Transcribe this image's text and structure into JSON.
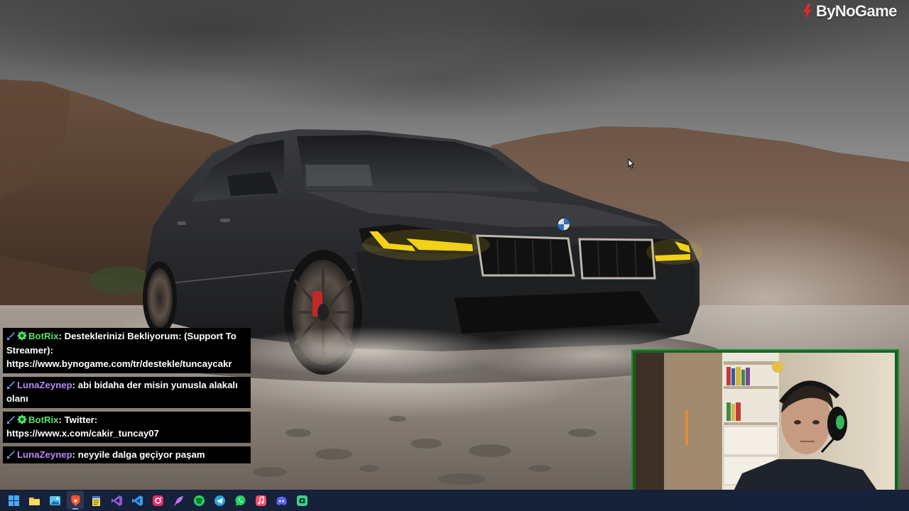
{
  "brand": {
    "name": "ByNoGame",
    "icon": "bynogame-logo-icon"
  },
  "wallpaper": {
    "subject": "car-wallpaper",
    "accent_headlight": "#f2d21a"
  },
  "chat": {
    "messages": [
      {
        "badge": "sword-icon",
        "bot_badge": "bot-icon",
        "user": "BotRix",
        "user_class": "botrix",
        "text": "Desteklerinizi Bekliyorum: (Support To Streamer): https://www.bynogame.com/tr/destekle/tuncaycakr"
      },
      {
        "badge": "sword-icon",
        "user": "LunaZeynep",
        "user_class": "luna",
        "text": "abi bidaha der misin yunusla alakalı olanı"
      },
      {
        "badge": "sword-icon",
        "bot_badge": "bot-icon",
        "user": "BotRix",
        "user_class": "botrix",
        "text": "Twitter: https://www.x.com/cakir_tuncay07"
      },
      {
        "badge": "sword-icon",
        "user": "LunaZeynep",
        "user_class": "luna",
        "text": "neyyile dalga geçiyor paşam"
      }
    ],
    "colors": {
      "botrix": "#57e36f",
      "luna": "#b88af5",
      "bg": "#000000"
    }
  },
  "webcam": {
    "frame_color": "#2a8a30"
  },
  "taskbar": {
    "apps": [
      {
        "name": "windows-start-icon",
        "color": "#4aa8ff"
      },
      {
        "name": "file-explorer-icon",
        "color": "#f5c342"
      },
      {
        "name": "photos-icon",
        "color": "#5cc0f0"
      },
      {
        "name": "brave-browser-icon",
        "color": "#fb542b",
        "active": true
      },
      {
        "name": "notepad-icon",
        "color": "#f0d64a"
      },
      {
        "name": "visual-studio-icon",
        "color": "#8a5cd6"
      },
      {
        "name": "vscode-icon",
        "color": "#2f9cf0"
      },
      {
        "name": "instagram-icon",
        "color": "#e1306c"
      },
      {
        "name": "feather-app-icon",
        "color": "#b07ae8"
      },
      {
        "name": "spotify-icon",
        "color": "#1ed760"
      },
      {
        "name": "telegram-icon",
        "color": "#2aa3e0"
      },
      {
        "name": "whatsapp-icon",
        "color": "#25d366"
      },
      {
        "name": "apple-music-icon",
        "color": "#fa4a68"
      },
      {
        "name": "discord-icon",
        "color": "#5865f2"
      },
      {
        "name": "streamer-app-icon",
        "color": "#3ecf8e"
      }
    ]
  }
}
